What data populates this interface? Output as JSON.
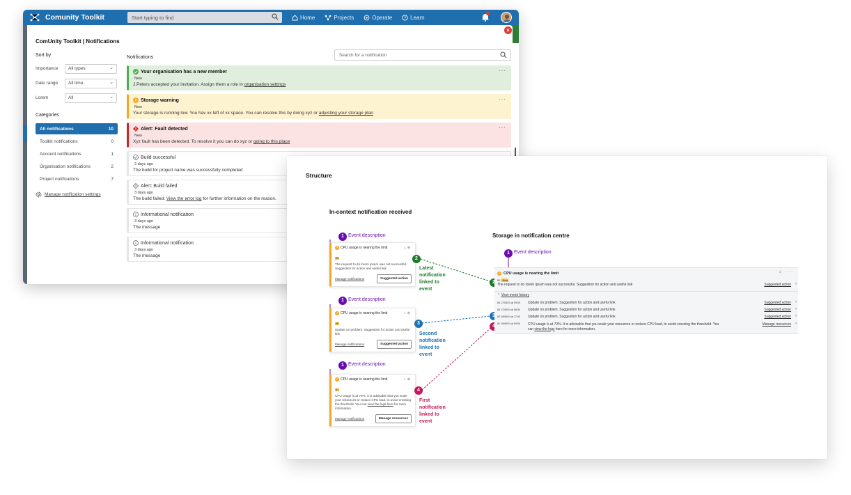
{
  "app": {
    "title": "Comunity Toolkit",
    "search_placeholder": "Start typing to find",
    "nav": [
      {
        "label": "Home",
        "icon": "home-icon"
      },
      {
        "label": "Projects",
        "icon": "projects-icon"
      },
      {
        "label": "Operate",
        "icon": "operate-icon"
      },
      {
        "label": "Learn",
        "icon": "learn-icon"
      }
    ],
    "colors": {
      "brand": "#1f6fae",
      "success": "#4caf50",
      "warning": "#f5a623",
      "alert": "#c62828"
    }
  },
  "panel": {
    "title": "ComUnity Toolkit | Notifications",
    "sort_label": "Sort by",
    "filters": [
      {
        "label": "Importance",
        "value": "All types"
      },
      {
        "label": "Date range",
        "value": "All time"
      },
      {
        "label": "Lorem",
        "value": "All"
      }
    ],
    "categories_label": "Categories",
    "categories": [
      {
        "label": "All notifications",
        "count": "10"
      },
      {
        "label": "Toolkit notifications",
        "count": "0"
      },
      {
        "label": "Account notifications",
        "count": "1"
      },
      {
        "label": "Organisation notifications",
        "count": "2"
      },
      {
        "label": "Project notifications",
        "count": "7"
      }
    ],
    "manage_settings": "Manage notification settings",
    "list_heading": "Notifications",
    "search_placeholder": "Search for a notification",
    "notifications": [
      {
        "title": "Your organisation has a new member",
        "sub": "New",
        "body": "J.Peters accepted your invitation. Assign them a role in ",
        "link": "organisation settings",
        "after": ""
      },
      {
        "title": "Storage warning",
        "sub": "New",
        "body": "Your storage is running low. You hav xx left of xx space. You can resolve this by doing xyz or ",
        "link": "adjusting your storage plan",
        "after": ""
      },
      {
        "title": "Alert: Fault detected",
        "sub": "New",
        "body": "Xyz fault has been detected. To resolve it you can do xyz or ",
        "link": "going to this place",
        "after": ""
      },
      {
        "title": "Build successful",
        "sub": "2 days ago",
        "body": "The build for project name was successfully completed",
        "link": "",
        "after": ""
      },
      {
        "title": "Alert: Build failed",
        "sub": "3 days ago",
        "body": "The build failed. ",
        "link": "View the error log",
        "after": " for further information on the reason."
      },
      {
        "title": "Informational notification",
        "sub": "3 days ago",
        "body": "The message",
        "link": "",
        "after": ""
      },
      {
        "title": "Informational notification",
        "sub": "3 days ago",
        "body": "The message",
        "link": "",
        "after": ""
      }
    ]
  },
  "structure": {
    "heading": "Structure",
    "in_context_heading": "In-context notification received",
    "storage_heading": "Storage in notification centre",
    "event_description": "Event description",
    "mini_title": "CPU usage is nearing the limit",
    "manage_notifications": "Manage notifications",
    "cards": [
      {
        "badge": "90",
        "body": "The request to do lorem ipsum was not successful. Suggestion for action and useful link",
        "link": "",
        "after": "",
        "button": "Suggested action"
      },
      {
        "badge": "85",
        "body": "Update on problem.  Suggestion for action and useful link",
        "link": "",
        "after": "",
        "button": "Suggested action"
      },
      {
        "badge": "81",
        "body": "CPU usage is at 70%. It is advisable that you scale your resources or reduce CPU load, to avoid crossing the threshold. You can ",
        "link": "view the logs here",
        "after": " for more information.",
        "button": "Manage resources"
      }
    ],
    "markers": [
      "1",
      "2",
      "3",
      "4"
    ],
    "captions": {
      "latest": [
        "Latest",
        "notification",
        "linked to",
        "event"
      ],
      "second": [
        "Second",
        "notification",
        "linked to",
        "event"
      ],
      "first": [
        "First",
        "notification",
        "linked to",
        "event"
      ]
    },
    "storage": {
      "title": "CPU usage is nearing the limit",
      "badge": "95",
      "new_tag": "New",
      "latest_body": "The request to do lorem ipsum was not successful. Suggestion for action and useful link",
      "suggested_action": "Suggested action",
      "view_history": "View event history",
      "history": [
        {
          "idx": "84",
          "ts": "17/05/24 at 09:00",
          "text": "Update on problem.  Suggestion for action and useful link",
          "action": "Suggested action"
        },
        {
          "idx": "83",
          "ts": "17/05/24 at 08:00",
          "text": "Update on problem.  Suggestion for action and useful link",
          "action": "Suggested action"
        },
        {
          "idx": "82",
          "ts": "16/05/24 at 17:00",
          "text": "Update on problem.  Suggestion for action and useful link",
          "action": "Suggested action"
        },
        {
          "idx": "81",
          "ts": "16/05/24 at 09:00",
          "text": "CPU usage is at 70%. It is advisable that you scale your resources or reduce CPU load, to avoid crossing the threshold. You can ",
          "link": "view the logs",
          "after": " here for more information.",
          "action": "Manage resources"
        }
      ]
    }
  }
}
